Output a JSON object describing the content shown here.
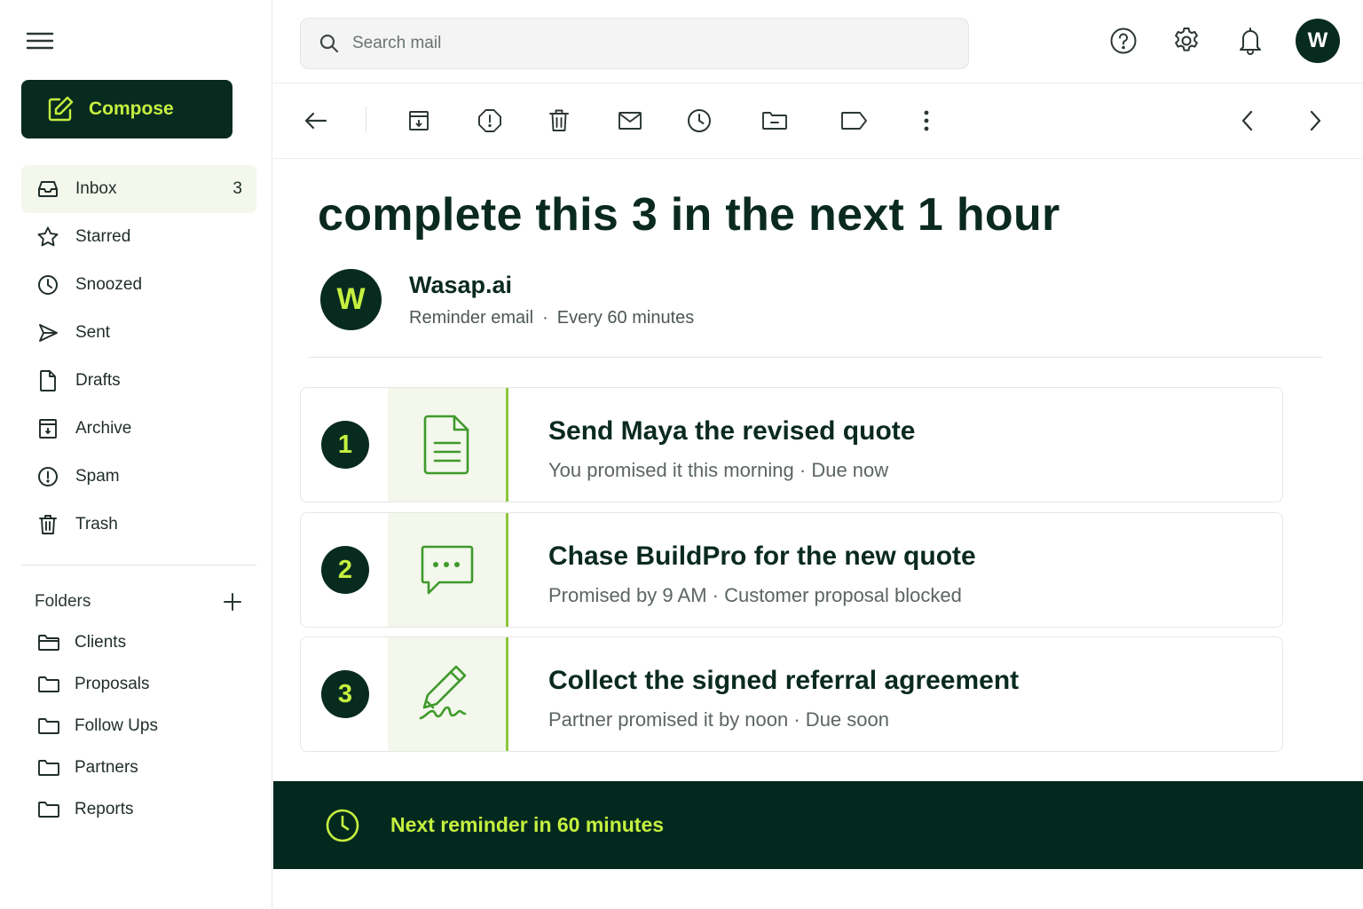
{
  "compose": {
    "label": "Compose"
  },
  "search": {
    "placeholder": "Search mail"
  },
  "user": {
    "initial": "W"
  },
  "nav": [
    {
      "label": "Inbox",
      "count": "3",
      "icon": "inbox-icon"
    },
    {
      "label": "Starred",
      "count": "",
      "icon": "star-icon"
    },
    {
      "label": "Snoozed",
      "count": "",
      "icon": "clock-icon"
    },
    {
      "label": "Sent",
      "count": "",
      "icon": "send-icon"
    },
    {
      "label": "Drafts",
      "count": "",
      "icon": "file-icon"
    },
    {
      "label": "Archive",
      "count": "",
      "icon": "archive-icon"
    },
    {
      "label": "Spam",
      "count": "",
      "icon": "alert-icon"
    },
    {
      "label": "Trash",
      "count": "",
      "icon": "trash-icon"
    }
  ],
  "folders": {
    "header": "Folders",
    "items": [
      "Clients",
      "Proposals",
      "Follow Ups",
      "Partners",
      "Reports"
    ]
  },
  "email": {
    "subject": "complete this 3 in the next 1 hour",
    "sender": {
      "initial": "W",
      "name": "Wasap.ai",
      "type": "Reminder email",
      "dot": "·",
      "frequency": "Every 60 minutes"
    },
    "tasks": [
      {
        "number": "1",
        "title": "Send Maya the revised quote",
        "subtitle": "You promised it this morning · Due now",
        "icon": "document-icon"
      },
      {
        "number": "2",
        "title": "Chase BuildPro for the new quote",
        "subtitle": "Promised by 9 AM · Customer proposal blocked",
        "icon": "chat-icon"
      },
      {
        "number": "3",
        "title": "Collect the signed referral agreement",
        "subtitle": "Partner promised it by noon  ·  Due soon",
        "icon": "signature-pen-icon"
      }
    ],
    "banner": "Next reminder in 60 minutes"
  },
  "colors": {
    "brand_dark": "#082b20",
    "accent_lime": "#c5f03f",
    "accent_green": "#8cc63f",
    "panel_bg": "#f3f7ec"
  }
}
